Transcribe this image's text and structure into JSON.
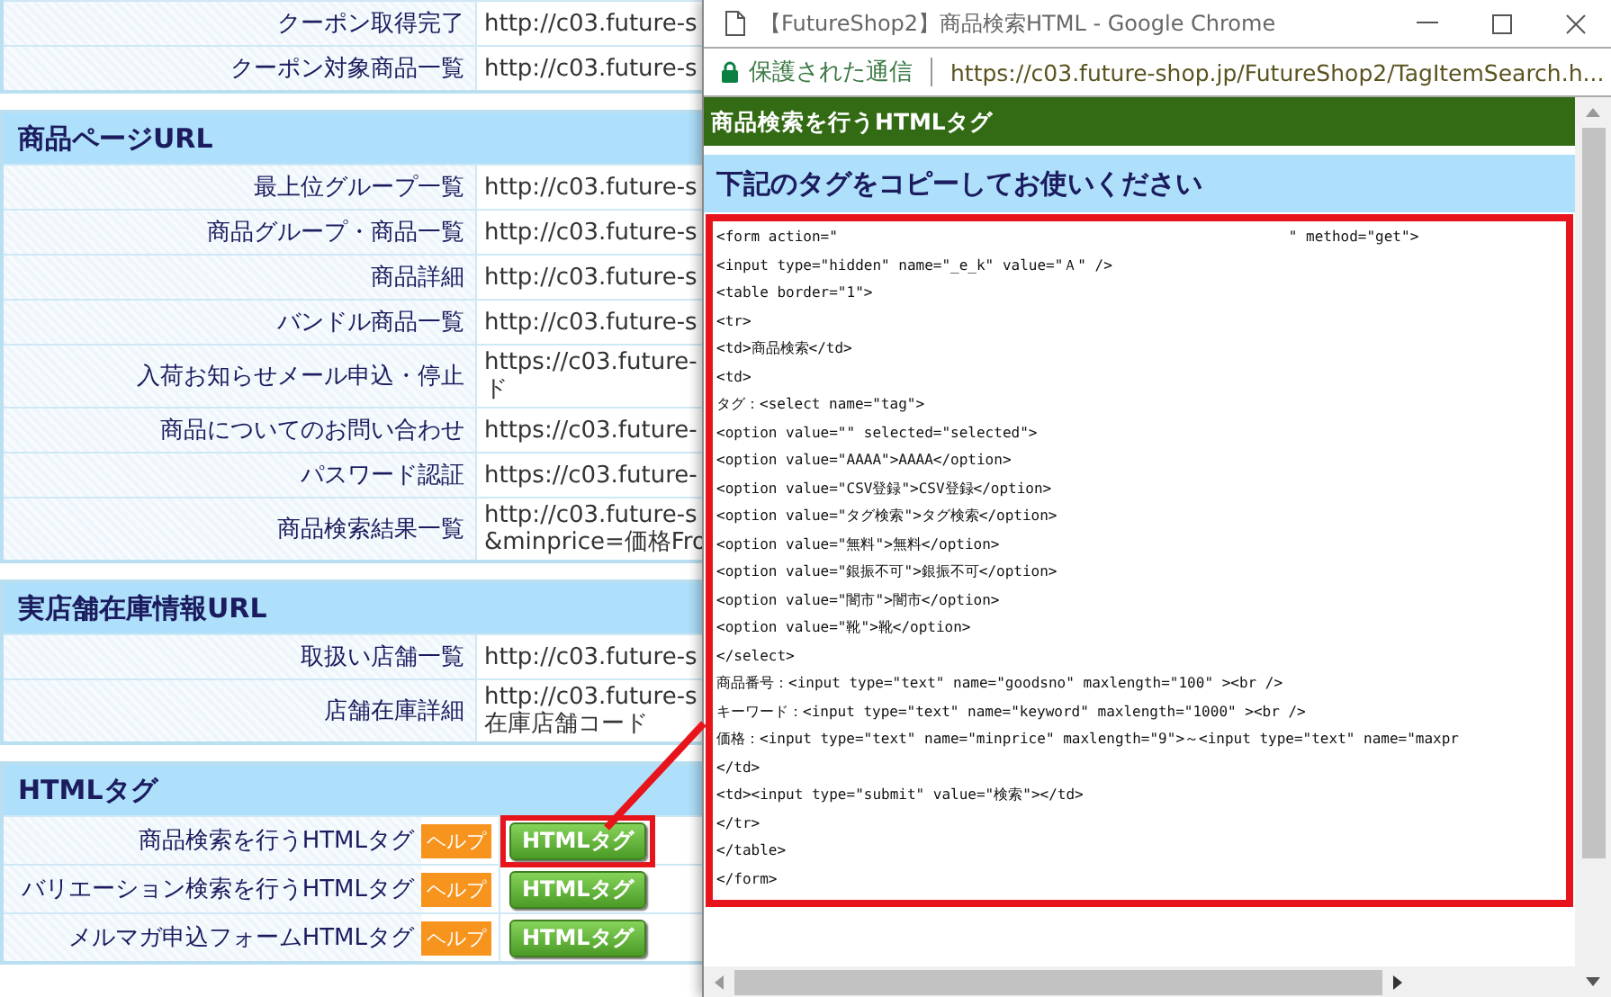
{
  "background_page": {
    "sections": [
      {
        "rows": [
          {
            "kind": "url",
            "label": "クーポン取得完了",
            "url_lines": [
              "http://c03.future-s"
            ]
          },
          {
            "kind": "url",
            "label": "クーポン対象商品一覧",
            "url_lines": [
              "http://c03.future-s"
            ]
          }
        ]
      },
      {
        "title": "商品ページURL",
        "rows": [
          {
            "kind": "url",
            "label": "最上位グループ一覧",
            "url_lines": [
              "http://c03.future-s"
            ]
          },
          {
            "kind": "url",
            "label": "商品グループ・商品一覧",
            "url_lines": [
              "http://c03.future-s"
            ]
          },
          {
            "kind": "url",
            "label": "商品詳細",
            "url_lines": [
              "http://c03.future-s"
            ]
          },
          {
            "kind": "url",
            "label": "バンドル商品一覧",
            "url_lines": [
              "http://c03.future-s"
            ]
          },
          {
            "kind": "url",
            "label": "入荷お知らせメール申込・停止",
            "url_lines": [
              "https://c03.future-",
              "ド"
            ]
          },
          {
            "kind": "url",
            "label": "商品についてのお問い合わせ",
            "url_lines": [
              "https://c03.future-"
            ]
          },
          {
            "kind": "url",
            "label": "パスワード認証",
            "url_lines": [
              "https://c03.future-"
            ]
          },
          {
            "kind": "url",
            "label": "商品検索結果一覧",
            "url_lines": [
              "http://c03.future-s",
              "&minprice=価格Fro"
            ]
          }
        ]
      },
      {
        "title": "実店舗在庫情報URL",
        "rows": [
          {
            "kind": "url",
            "label": "取扱い店舗一覧",
            "url_lines": [
              "http://c03.future-s"
            ]
          },
          {
            "kind": "url",
            "label": "店舗在庫詳細",
            "url_lines": [
              "http://c03.future-s",
              "在庫店舗コード"
            ]
          }
        ]
      },
      {
        "title": "HTMLタグ",
        "rows": [
          {
            "kind": "tag",
            "label": "商品検索を行うHTMLタグ",
            "help": "ヘルプ",
            "button": "HTMLタグ",
            "highlighted": true
          },
          {
            "kind": "tag",
            "label": "バリエーション検索を行うHTMLタグ",
            "help": "ヘルプ",
            "button": "HTMLタグ",
            "highlighted": false
          },
          {
            "kind": "tag",
            "label": "メルマガ申込フォームHTMLタグ",
            "help": "ヘルプ",
            "button": "HTMLタグ",
            "highlighted": false
          }
        ]
      }
    ]
  },
  "popup": {
    "window_title": "【FutureShop2】商品検索HTML - Google Chrome",
    "security_label": "保護された通信",
    "url": "https://c03.future-shop.jp/FutureShop2/TagItemSearch.h...",
    "header": "商品検索を行うHTMLタグ",
    "instruction": "下記のタグをコピーしてお使いください",
    "code_lines": [
      "<form action=\"                                                    \" method=\"get\">",
      "<input type=\"hidden\" name=\"_e_k\" value=\"Ａ\" />",
      "<table border=\"1\">",
      "<tr>",
      "<td>商品検索</td>",
      "<td>",
      "タグ：<select name=\"tag\">",
      "<option value=\"\" selected=\"selected\">",
      "<option value=\"AAAA\">AAAA</option>",
      "<option value=\"CSV登録\">CSV登録</option>",
      "<option value=\"タグ検索\">タグ検索</option>",
      "<option value=\"無料\">無料</option>",
      "<option value=\"銀振不可\">銀振不可</option>",
      "<option value=\"闇市\">闇市</option>",
      "<option value=\"靴\">靴</option>",
      "</select>",
      "商品番号：<input type=\"text\" name=\"goodsno\" maxlength=\"100\" ><br />",
      "キーワード：<input type=\"text\" name=\"keyword\" maxlength=\"1000\" ><br />",
      "価格：<input type=\"text\" name=\"minprice\" maxlength=\"9\">～<input type=\"text\" name=\"maxpr",
      "</td>",
      "<td><input type=\"submit\" value=\"検索\"></td>",
      "</tr>",
      "</table>",
      "</form>"
    ]
  }
}
